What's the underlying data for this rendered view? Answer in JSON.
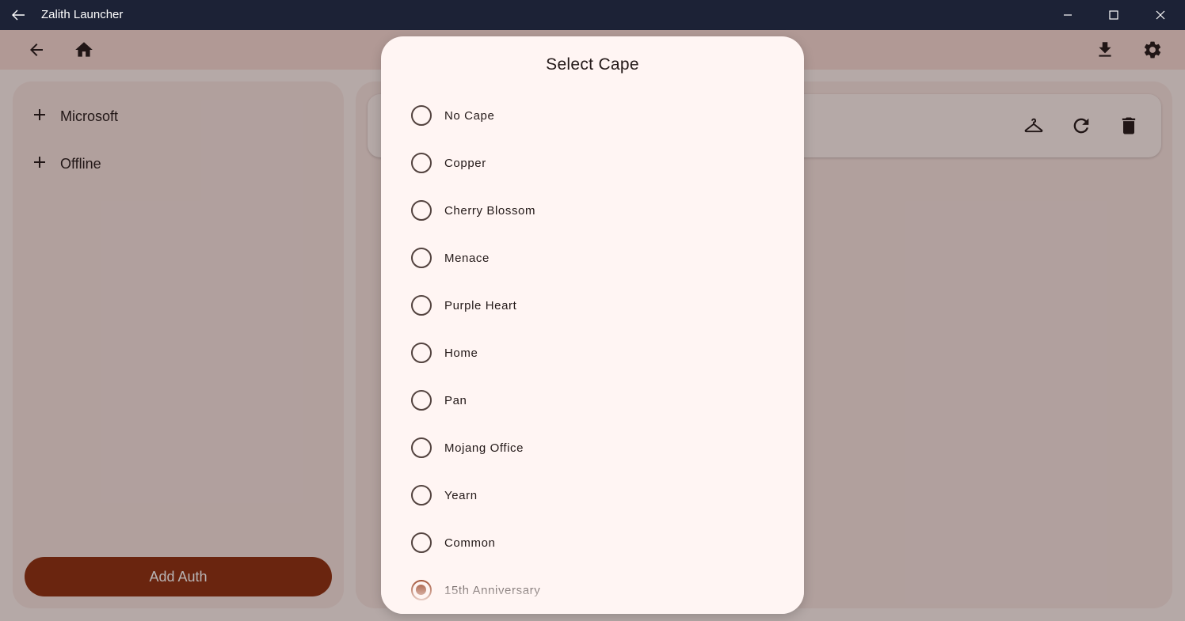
{
  "window": {
    "title": "Zalith Launcher",
    "back_icon": "arrow-left-icon",
    "controls": [
      "minimize-icon",
      "maximize-icon",
      "close-icon"
    ]
  },
  "appbar": {
    "left_icons": [
      "arrow-back-icon",
      "home-icon"
    ],
    "right_icons": [
      "download-icon",
      "settings-icon"
    ]
  },
  "left_panel": {
    "account_types": [
      {
        "label": "Microsoft",
        "icon": "plus-icon"
      },
      {
        "label": "Offline",
        "icon": "plus-icon"
      }
    ],
    "add_auth_label": "Add Auth"
  },
  "account_card": {
    "icons": [
      "hanger-icon",
      "refresh-icon",
      "delete-icon"
    ]
  },
  "dialog": {
    "title": "Select Cape",
    "options": [
      {
        "label": "No Cape",
        "selected": false
      },
      {
        "label": "Copper",
        "selected": false
      },
      {
        "label": "Cherry Blossom",
        "selected": false
      },
      {
        "label": "Menace",
        "selected": false
      },
      {
        "label": "Purple Heart",
        "selected": false
      },
      {
        "label": "Home",
        "selected": false
      },
      {
        "label": "Pan",
        "selected": false
      },
      {
        "label": "Mojang Office",
        "selected": false
      },
      {
        "label": "Yearn",
        "selected": false
      },
      {
        "label": "Common",
        "selected": false
      },
      {
        "label": "15th Anniversary",
        "selected": true
      }
    ]
  },
  "colors": {
    "titlebar": "#1c2236",
    "accent": "#8e2f0e",
    "surface": "#fff5f3",
    "on_surface": "#231918"
  }
}
